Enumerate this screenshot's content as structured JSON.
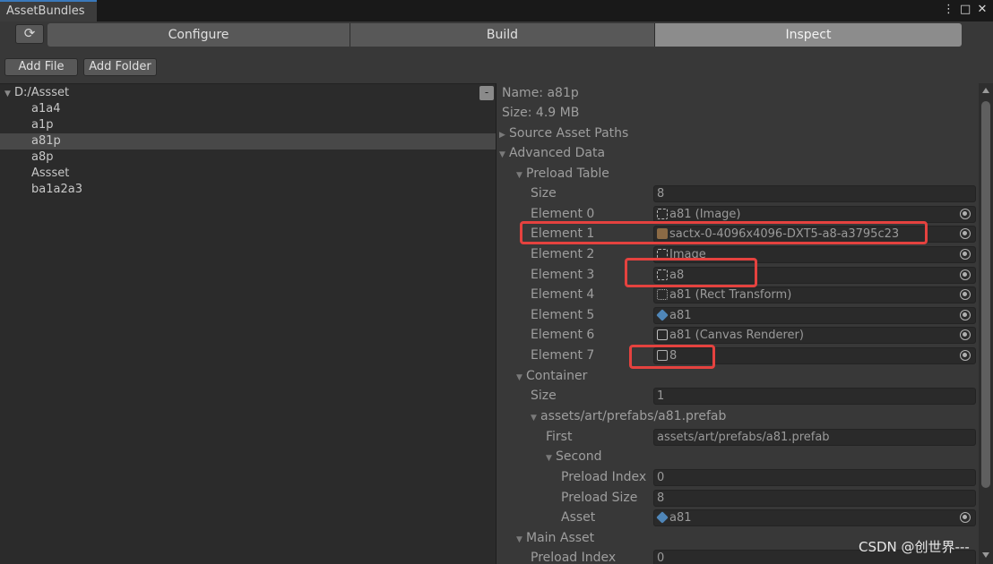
{
  "window": {
    "tab_title": "AssetBundles",
    "menu_icon": "⋮",
    "maximize_icon": "□",
    "close_icon": "✕"
  },
  "toolbar": {
    "refresh_icon": "⟳",
    "tabs": [
      {
        "label": "Configure"
      },
      {
        "label": "Build"
      },
      {
        "label": "Inspect"
      }
    ],
    "active_tab": "Inspect",
    "add_file": "Add File",
    "add_folder": "Add Folder"
  },
  "tree": {
    "root": "D:/Assset",
    "collapse_label": "-",
    "items": [
      "a1a4",
      "a1p",
      "a81p",
      "a8p",
      "Assset",
      "ba1a2a3"
    ],
    "selected": "a81p"
  },
  "inspector": {
    "name": "Name: a81p",
    "size": "Size: 4.9 MB",
    "source_asset_paths": "Source Asset Paths",
    "advanced_data": "Advanced Data",
    "preload_table": {
      "label": "Preload Table",
      "size_label": "Size",
      "size_value": "8",
      "elements": [
        {
          "label": "Element 0",
          "value": "a81 (Image)",
          "icon": "image-icon"
        },
        {
          "label": "Element 1",
          "value": "sactx-0-4096x4096-DXT5-a8-a3795c23",
          "icon": "texture-icon"
        },
        {
          "label": "Element 2",
          "value": "Image",
          "icon": "image-icon"
        },
        {
          "label": "Element 3",
          "value": "a8",
          "icon": "image-icon"
        },
        {
          "label": "Element 4",
          "value": "a81 (Rect Transform)",
          "icon": "rect-transform-icon"
        },
        {
          "label": "Element 5",
          "value": "a81",
          "icon": "prefab-cube-icon"
        },
        {
          "label": "Element 6",
          "value": "a81 (Canvas Renderer)",
          "icon": "canvas-renderer-icon"
        },
        {
          "label": "Element 7",
          "value": "8",
          "icon": "object-icon"
        }
      ]
    },
    "container": {
      "label": "Container",
      "size_label": "Size",
      "size_value": "1",
      "entry_label": "assets/art/prefabs/a81.prefab",
      "first_label": "First",
      "first_value": "assets/art/prefabs/a81.prefab",
      "second_label": "Second",
      "preload_index_label": "Preload Index",
      "preload_index_value": "0",
      "preload_size_label": "Preload Size",
      "preload_size_value": "8",
      "asset_label": "Asset",
      "asset_value": "a81"
    },
    "main_asset": {
      "label": "Main Asset",
      "preload_index_label": "Preload Index",
      "preload_index_value": "0"
    }
  },
  "watermark": "CSDN @创世界---",
  "colors": {
    "highlight": "#e5423f",
    "selected_row": "#484848",
    "tab_accent": "#3a79bb"
  }
}
